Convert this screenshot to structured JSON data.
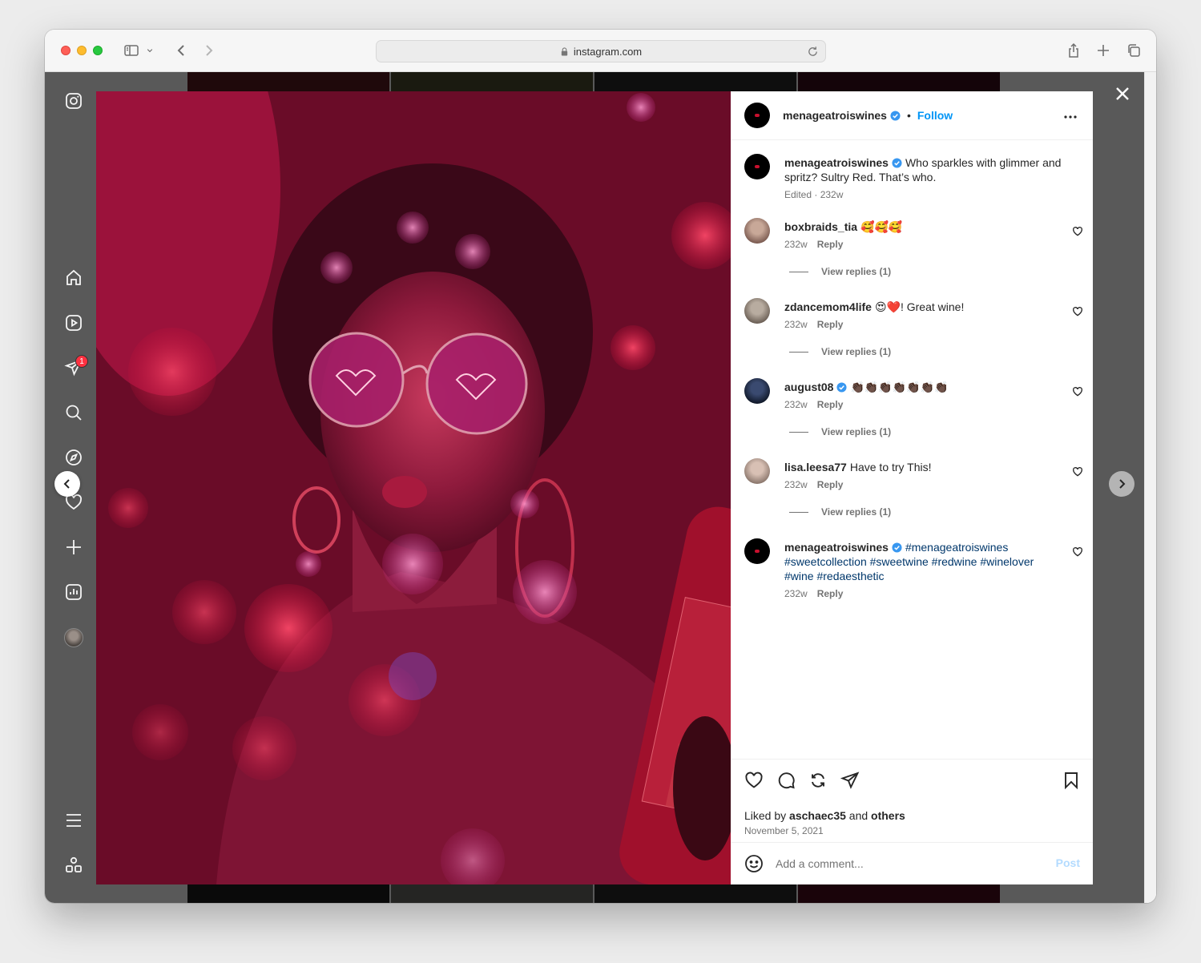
{
  "browser": {
    "url": "instagram.com"
  },
  "nav": {
    "notification_count": "1"
  },
  "post": {
    "username": "menageatroiswines",
    "follow_label": "Follow",
    "separator": "•",
    "caption": {
      "username": "menageatroiswines",
      "text": "Who sparkles with glimmer and spritz? Sultry Red. That’s who.",
      "meta": "Edited · 232w"
    },
    "comments": [
      {
        "username": "boxbraids_tia",
        "text": "🥰🥰🥰",
        "time": "232w",
        "reply_label": "Reply",
        "view_replies": "View replies (1)",
        "avatar_color": "#7a5a50"
      },
      {
        "username": "zdancemom4life",
        "text": "😍❤️! Great wine!",
        "time": "232w",
        "reply_label": "Reply",
        "view_replies": "View replies (1)",
        "avatar_color": "#8c7f74"
      },
      {
        "username": "august08",
        "text": "👏🏿👏🏿👏🏿👏🏿👏🏿👏🏿👏🏿",
        "time": "232w",
        "reply_label": "Reply",
        "view_replies": "View replies (1)",
        "avatar_color": "#1a2540"
      },
      {
        "username": "lisa.leesa77",
        "text": "Have to try This!",
        "time": "232w",
        "reply_label": "Reply",
        "view_replies": "View replies (1)",
        "avatar_color": "#a8968c"
      },
      {
        "username": "menageatroiswines",
        "hashtags": "#menageatroiswines #sweetcollection #sweetwine #redwine #winelover #wine #redaesthetic",
        "time": "232w",
        "reply_label": "Reply"
      }
    ],
    "likes": {
      "prefix": "Liked by",
      "user": "aschaec35",
      "and": "and",
      "others": "others"
    },
    "date": "November 5, 2021",
    "add_comment_placeholder": "Add a comment...",
    "post_label": "Post"
  },
  "colors": {
    "accent": "#0095f6",
    "verified": "#3897f0",
    "badge": "#ff3040"
  },
  "icons": {
    "nav": [
      "instagram-icon",
      "home-icon",
      "reels-icon",
      "messages-icon",
      "search-icon",
      "explore-icon",
      "notifications-icon",
      "create-icon",
      "dashboard-icon",
      "profile-avatar",
      "menu-icon",
      "more-apps-icon"
    ],
    "actions": [
      "like-icon",
      "comment-icon",
      "repost-icon",
      "share-icon",
      "save-icon"
    ]
  }
}
